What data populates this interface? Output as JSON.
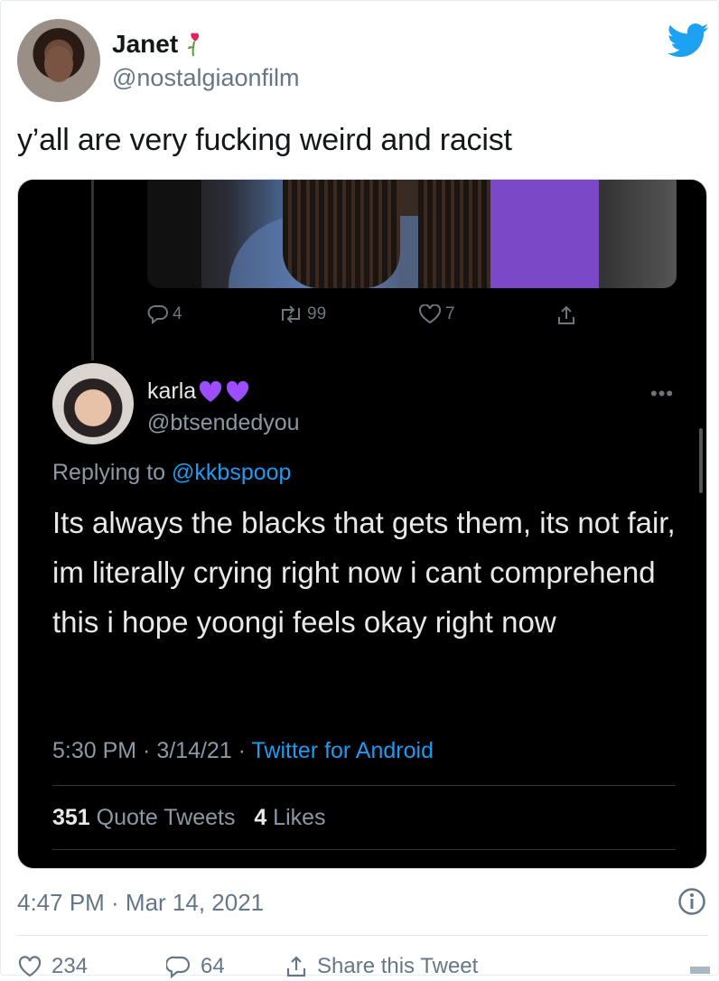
{
  "tweet": {
    "author_name": "Janet",
    "author_handle": "@nostalgiaonfilm",
    "text": "y’all are very fucking weird and racist",
    "timestamp": "4:47 PM · Mar 14, 2021",
    "likes": "234",
    "replies": "64",
    "share_label": "Share this Tweet"
  },
  "embedded": {
    "parent_actions": {
      "replies": "4",
      "retweets": "99",
      "likes": "7"
    },
    "author_name": "karla",
    "author_handle": "@btsendedyou",
    "replying_prefix": "Replying to",
    "replying_to": "@kkbspoop",
    "text": "Its always the blacks that gets them, its not fair, im literally crying right now i cant comprehend this i hope yoongi feels okay right now",
    "time": "5:30 PM · 3/14/21 · ",
    "app": "Twitter for Android",
    "quote_count": "351",
    "quote_label": "Quote Tweets",
    "like_count": "4",
    "like_label": "Likes"
  },
  "colors": {
    "twitter_blue": "#1da1f2",
    "dark_bg": "#000000",
    "purple_heart": "#9b4dff"
  }
}
